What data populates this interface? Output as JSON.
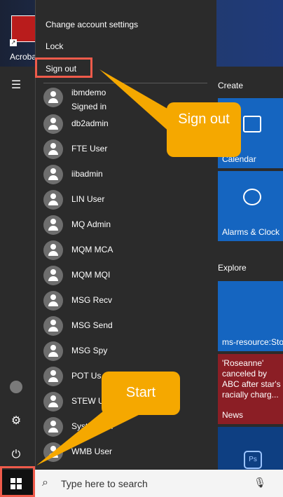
{
  "desktop": {
    "icon_label": "Acroba"
  },
  "account_menu": {
    "change_settings": "Change account settings",
    "lock": "Lock",
    "sign_out": "Sign out"
  },
  "users": [
    {
      "name": "ibmdemo",
      "status": "Signed in"
    },
    {
      "name": "db2admin"
    },
    {
      "name": "FTE User"
    },
    {
      "name": "iibadmin"
    },
    {
      "name": "LIN User"
    },
    {
      "name": "MQ Admin"
    },
    {
      "name": "MQM MCA"
    },
    {
      "name": "MQM MQI"
    },
    {
      "name": "MSG Recv"
    },
    {
      "name": "MSG Send"
    },
    {
      "name": "MSG Spy"
    },
    {
      "name": "POT Us"
    },
    {
      "name": "STEW U"
    },
    {
      "name": "Syst admin"
    },
    {
      "name": "WMB User"
    }
  ],
  "tiles": {
    "create_label": "Create",
    "calendar": "Calendar",
    "alarms": "Alarms & Clock",
    "explore_label": "Explore",
    "store": "ms-resource:Sto",
    "news_text": "'Roseanne' canceled by ABC after star's racially charg...",
    "news_label": "News",
    "ps_glyph": "Ps"
  },
  "taskbar": {
    "search_placeholder": "Type here to search"
  },
  "callouts": {
    "sign_out": "Sign out",
    "start": "Start"
  },
  "colors": {
    "highlight": "#ef5b4b",
    "callout": "#f5a800",
    "tile": "#1565c0"
  }
}
